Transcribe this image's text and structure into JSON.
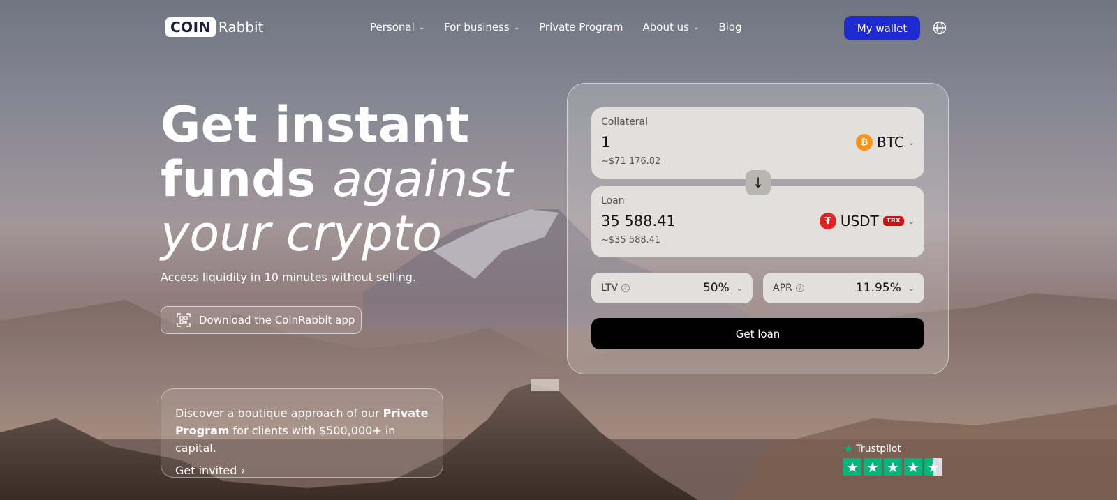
{
  "nav": {
    "logo_box": "COIN",
    "logo_text": "Rabbit",
    "items": [
      {
        "label": "Personal",
        "has_dropdown": true
      },
      {
        "label": "For business",
        "has_dropdown": true
      },
      {
        "label": "Private Program",
        "has_dropdown": false
      },
      {
        "label": "About us",
        "has_dropdown": true
      },
      {
        "label": "Blog",
        "has_dropdown": false
      }
    ],
    "wallet_label": "My wallet",
    "wallet_color": "#1f2bd1"
  },
  "hero": {
    "title_line1": "Get instant",
    "title_line2_bold": "funds",
    "title_line2_italic": "against",
    "title_line3_italic": "your crypto",
    "subtitle": "Access liquidity in 10 minutes without selling.",
    "app_button": "Download the CoinRabbit app"
  },
  "promo": {
    "text_before": "Discover a boutique approach of our",
    "text_bold": "Private Program",
    "text_after": "for clients with $500,000+ in capital.",
    "link": "Get invited"
  },
  "calculator": {
    "collateral": {
      "label": "Collateral",
      "value": "1",
      "usd": "~$71 176.82",
      "coin": "BTC",
      "icon": "bitcoin-icon"
    },
    "loan": {
      "label": "Loan",
      "value": "35 588.41",
      "usd": "~$35 588.41",
      "coin": "USDT",
      "network": "TRX",
      "icon": "tether-icon"
    },
    "ltv": {
      "label": "LTV",
      "value": "50%"
    },
    "apr": {
      "label": "APR",
      "value": "11.95%"
    },
    "submit": "Get loan"
  },
  "trustpilot": {
    "label": "Trustpilot",
    "rating_stars": 4.5
  }
}
